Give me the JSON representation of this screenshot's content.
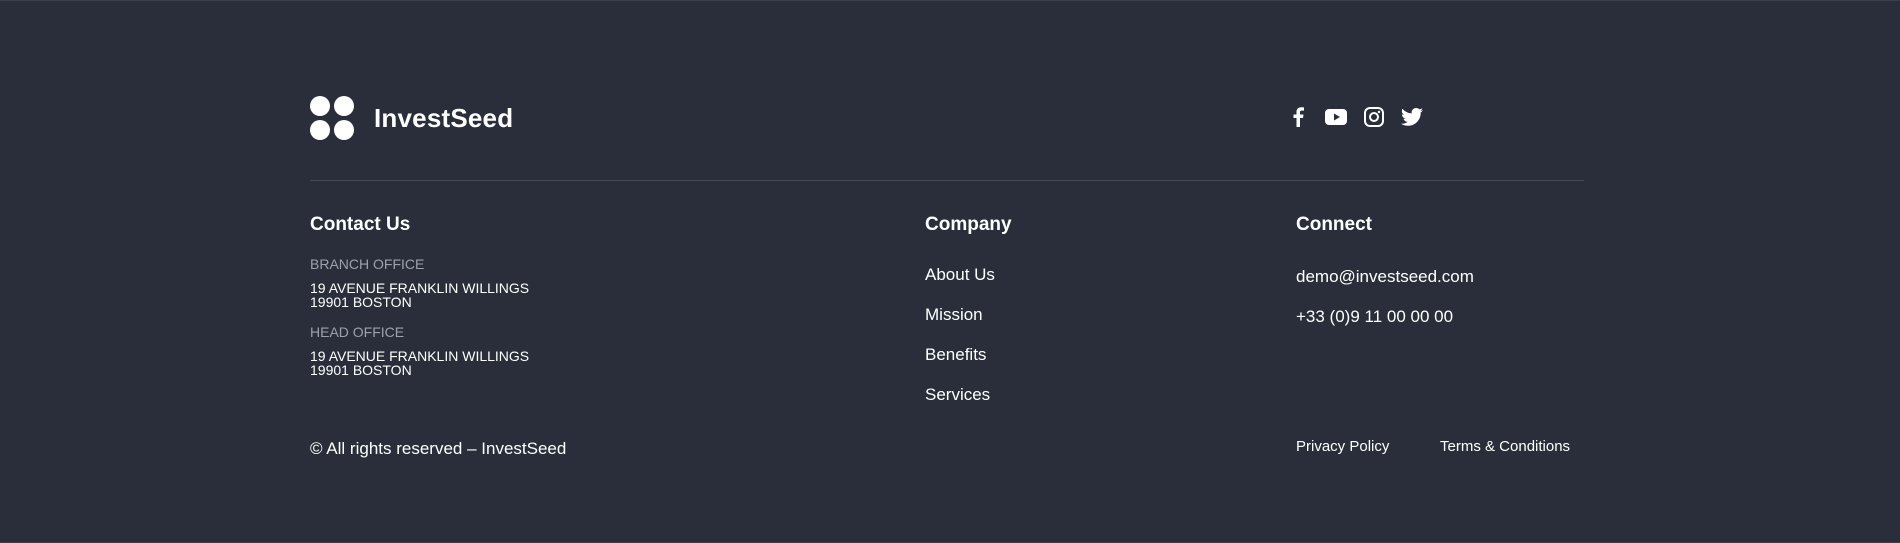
{
  "brand": {
    "name": "InvestSeed",
    "logo_icon": "four-circles-logo"
  },
  "socials": [
    {
      "icon": "facebook-icon"
    },
    {
      "icon": "youtube-icon"
    },
    {
      "icon": "instagram-icon"
    },
    {
      "icon": "twitter-icon"
    }
  ],
  "contact": {
    "title": "Contact Us",
    "branch": {
      "label": "BRANCH OFFICE",
      "line1": "19 AVENUE FRANKLIN WILLINGS",
      "line2": "19901 BOSTON"
    },
    "head": {
      "label": "HEAD OFFICE",
      "line1": "19 AVENUE FRANKLIN WILLINGS",
      "line2": "19901 BOSTON"
    }
  },
  "company": {
    "title": "Company",
    "links": [
      "About Us",
      "Mission",
      "Benefits",
      "Services"
    ]
  },
  "connect": {
    "title": "Connect",
    "email": "demo@investseed.com",
    "phone": "+33 (0)9 11 00 00 00"
  },
  "bottom": {
    "copyright": "© All rights reserved – InvestSeed",
    "privacy": "Privacy Policy",
    "terms": "Terms & Conditions"
  },
  "colors": {
    "background": "#292e3a",
    "text": "#ffffff",
    "muted": "#9da1ab",
    "divider": "#434856"
  }
}
